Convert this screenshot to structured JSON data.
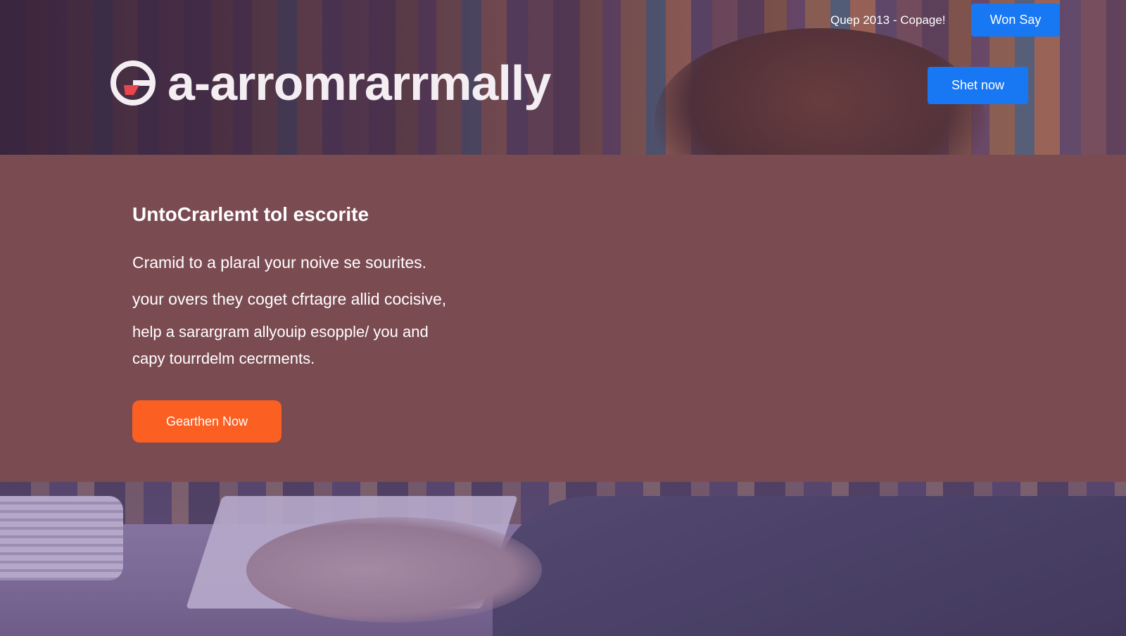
{
  "header": {
    "logo_text": "a-arromrarrmally",
    "top_link": "Quep 2013 - Copage!",
    "won_say_button": "Won Say",
    "shet_now_button": "Shet now"
  },
  "main": {
    "title": "UntoCrarlemt tol escorite",
    "lines": [
      "Cramid to a plaral your noive se sourites.",
      "your overs they coget cfrtagre allid cocisive,",
      "help a sarargram allyouip esopple/ you and",
      "capy tourrdelm cecrments."
    ],
    "cta_button": "Gearthen Now"
  },
  "colors": {
    "band": "#7b4b52",
    "primary_blue": "#1877f2",
    "cta_orange": "#fb5f22",
    "logo_red": "#e8464e"
  }
}
